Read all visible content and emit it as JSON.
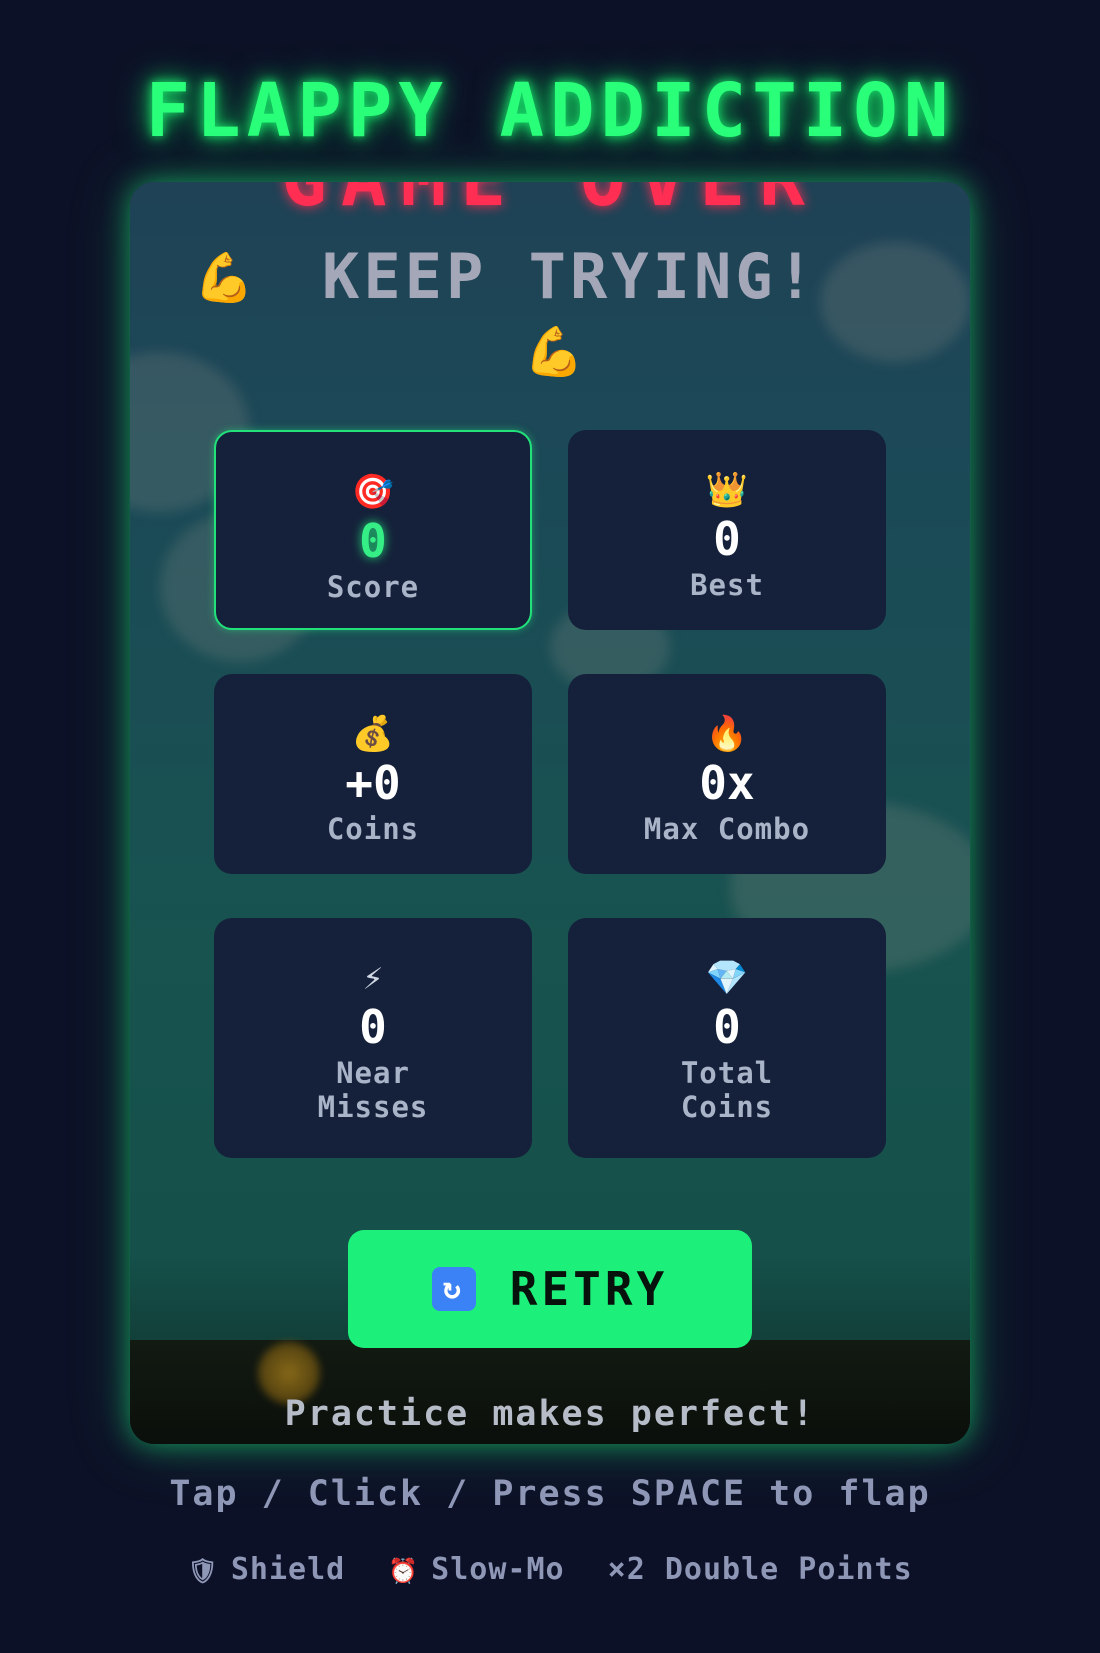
{
  "title": "FLAPPY ADDICTION",
  "game_over": {
    "heading": "GAME OVER",
    "subtitle": "KEEP TRYING!",
    "emoji": "💪",
    "tagline": "Practice makes perfect!"
  },
  "stats": [
    {
      "icon": "🎯",
      "icon_name": "target-icon",
      "value": "0",
      "label": "Score"
    },
    {
      "icon": "👑",
      "icon_name": "crown-icon",
      "value": "0",
      "label": "Best"
    },
    {
      "icon": "💰",
      "icon_name": "money-bag-icon",
      "value": "+0",
      "label": "Coins"
    },
    {
      "icon": "🔥",
      "icon_name": "fire-icon",
      "value": "0x",
      "label": "Max Combo"
    },
    {
      "icon": "⚡",
      "icon_name": "lightning-icon",
      "value": "0",
      "label": "Near Misses"
    },
    {
      "icon": "💎",
      "icon_name": "diamond-icon",
      "value": "0",
      "label": "Total Coins"
    }
  ],
  "retry": {
    "icon": "🔄",
    "label": "RETRY"
  },
  "instructions": "Tap / Click / Press SPACE to flap",
  "powerups": [
    {
      "icon": "🛡",
      "icon_name": "shield-icon",
      "label": "Shield"
    },
    {
      "icon": "⏰",
      "icon_name": "alarm-clock-icon",
      "label": "Slow-Mo"
    },
    {
      "icon": "",
      "icon_name": "",
      "label": "×2 Double Points"
    }
  ],
  "colors": {
    "background": "#0d1127",
    "title_green": "#2aff7a",
    "game_over_red": "#ff2e52",
    "retry_green": "#1df07a",
    "card_bg": "#15213a"
  }
}
